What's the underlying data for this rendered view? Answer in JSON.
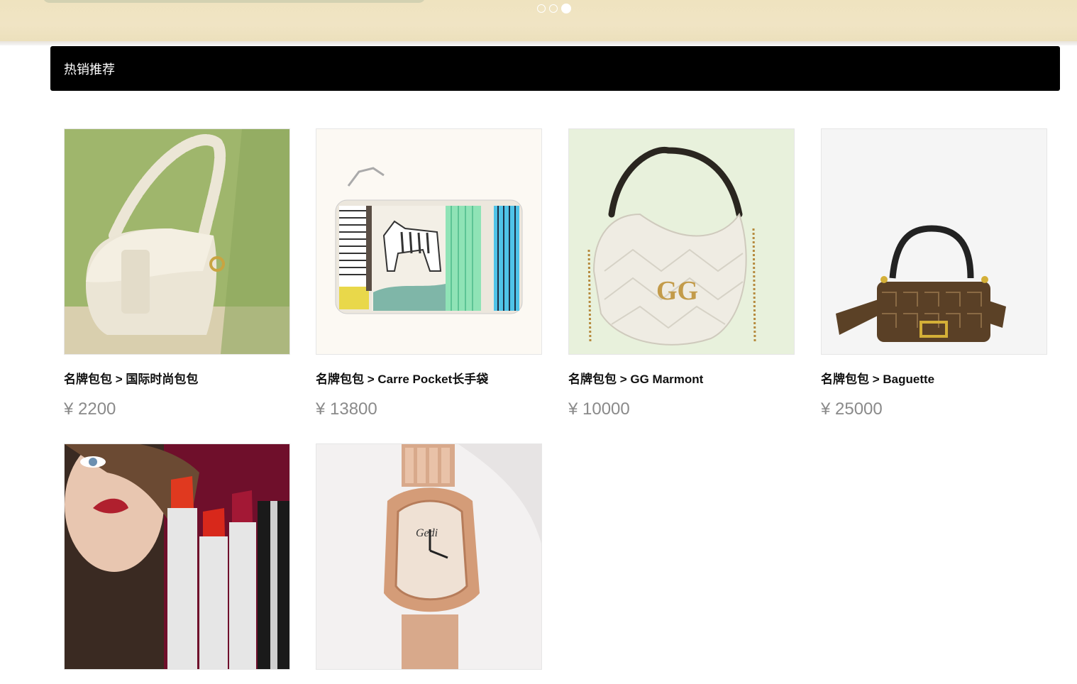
{
  "banner": {
    "dots": [
      {
        "active": false
      },
      {
        "active": false
      },
      {
        "active": true
      }
    ]
  },
  "section": {
    "title": "热销推荐"
  },
  "products": [
    {
      "name": "名牌包包 > 国际时尚包包",
      "price": "¥ 2200",
      "image": "white-saddle-bag"
    },
    {
      "name": "名牌包包 > Carre Pocket长手袋",
      "price": "¥ 13800",
      "image": "zebra-pouch"
    },
    {
      "name": "名牌包包 > GG Marmont",
      "price": "¥ 10000",
      "image": "white-hobo-bag"
    },
    {
      "name": "名牌包包 > Baguette",
      "price": "¥ 25000",
      "image": "ff-baguette-bag"
    },
    {
      "name": "",
      "price": "",
      "image": "lipstick-model"
    },
    {
      "name": "",
      "price": "",
      "image": "rose-gold-watch"
    }
  ],
  "colors": {
    "section_bar": "#000000",
    "price_text": "#8a8a8a"
  }
}
